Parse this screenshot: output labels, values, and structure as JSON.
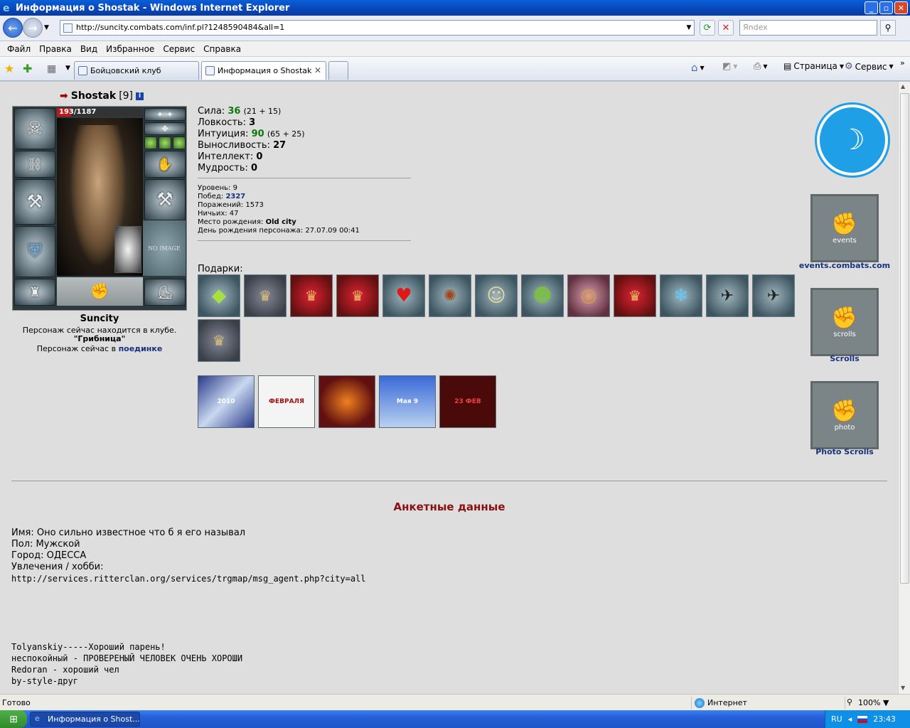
{
  "window": {
    "title": "Информация о Shostak - Windows Internet Explorer"
  },
  "address": {
    "url": "http://suncity.combats.com/inf.pl?1248590484&all=1",
    "search_placeholder": "Яndex"
  },
  "menu": [
    "Файл",
    "Правка",
    "Вид",
    "Избранное",
    "Сервис",
    "Справка"
  ],
  "tabs": [
    {
      "label": "Бойцовский клуб"
    },
    {
      "label": "Информация о Shostak"
    }
  ],
  "commandbar": {
    "page": "Страница",
    "tools": "Сервис"
  },
  "character": {
    "name": "Shostak",
    "level": "[9]",
    "hp": "193",
    "hp_max": "/1187",
    "hp_fraction": 0.163,
    "no_image": "NO IMAGE",
    "city": "Suncity",
    "location_line1": "Персонаж сейчас находится в клубе.",
    "location_club": "\"Грибница\"",
    "location_line3_prefix": "Персонаж сейчас в",
    "location_line3_link": "поединке"
  },
  "stats": {
    "strength_label": "Сила:",
    "strength": "36",
    "strength_extra": "(21 + 15)",
    "agility_label": "Ловкость:",
    "agility": "3",
    "intuition_label": "Интуиция:",
    "intuition": "90",
    "intuition_extra": "(65 + 25)",
    "endurance_label": "Выносливость:",
    "endurance": "27",
    "intellect_label": "Интеллект:",
    "intellect": "0",
    "wisdom_label": "Мудрость:",
    "wisdom": "0"
  },
  "info": {
    "level_label": "Уровень:",
    "level": "9",
    "wins_label": "Побед:",
    "wins": "2327",
    "losses_label": "Поражений:",
    "losses": "1573",
    "draws_label": "Ничьих:",
    "draws": "47",
    "birthplace_label": "Место рождения:",
    "birthplace": "Old city",
    "birthday_label": "День рождения персонажа:",
    "birthday": "27.07.09 00:41"
  },
  "gifts": {
    "label": "Подарки:"
  },
  "cards": {
    "c1": "2010",
    "c2": "ФЕВРАЛЯ",
    "c3": "",
    "c4": "Мая 9",
    "c5": "23 ФЕВ"
  },
  "right_links": {
    "events": "events.combats.com",
    "scrolls": "Scrolls",
    "photo": "Photo Scrolls",
    "banner_events": "events",
    "banner_scrolls": "scrolls",
    "banner_photo": "photo"
  },
  "anketa": {
    "title": "Анкетные данные",
    "name_line": "Имя: Оно сильно известное что б я его называл",
    "gender_line": "Пол: Мужской",
    "city_line": "Город: ОДЕССА",
    "hobby_line": "Увлечения / хобби:",
    "hobby_url": "http://services.ritterclan.org/services/trgmap/msg_agent.php?city=all",
    "comments": [
      "Tolyanskiy-----Хороший парень!",
      "неспокойный - ПРОВЕРЕНЫЙ ЧЕЛОВЕК ОЧЕНЬ ХОРОШИ",
      "Redoran - хороший чел",
      "by-style-друг"
    ]
  },
  "status": {
    "done": "Готово",
    "zone": "Интернет",
    "zoom": "100%"
  },
  "taskbar": {
    "item": "Информация о Shost...",
    "lang": "RU",
    "time": "23:43"
  },
  "colors": {
    "accent_link": "#16327f",
    "stat_green": "#0b7a0b",
    "anketa_title": "#8a1010",
    "titlebar": "#0a5fd8"
  }
}
